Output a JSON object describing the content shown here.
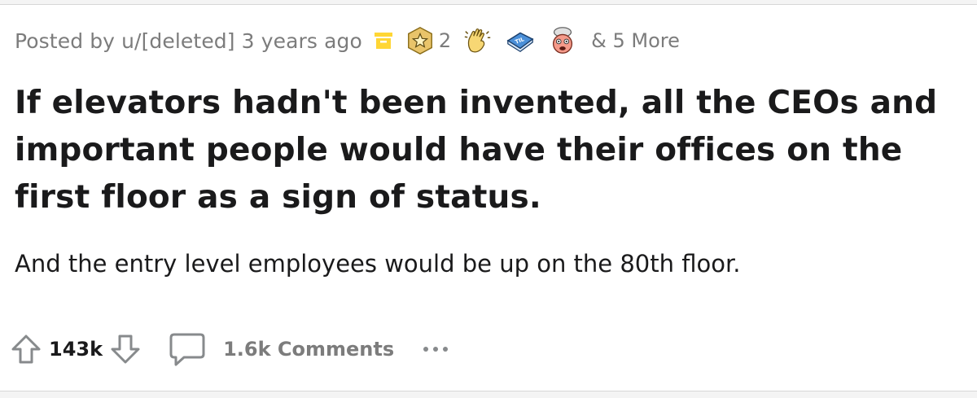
{
  "post": {
    "meta_text": "Posted by u/[deleted] 3 years ago",
    "awards": [
      {
        "icon": "silver-star-award-icon",
        "count": "2"
      },
      {
        "icon": "clapping-hands-award-icon",
        "count": ""
      },
      {
        "icon": "til-book-award-icon",
        "count": ""
      },
      {
        "icon": "mind-blown-award-icon",
        "count": ""
      }
    ],
    "more_awards": "& 5 More",
    "title": "If elevators hadn't been invented, all the CEOs and important people would have their offices on the first floor as a sign of status.",
    "body": "And the entry level employees would be up on the 80th floor."
  },
  "actions": {
    "score": "143k",
    "comments_label": "1.6k Comments"
  },
  "colors": {
    "meta_gray": "#7c7c7c",
    "text_dark": "#1a1a1b",
    "archive_yellow": "#ffd635"
  }
}
